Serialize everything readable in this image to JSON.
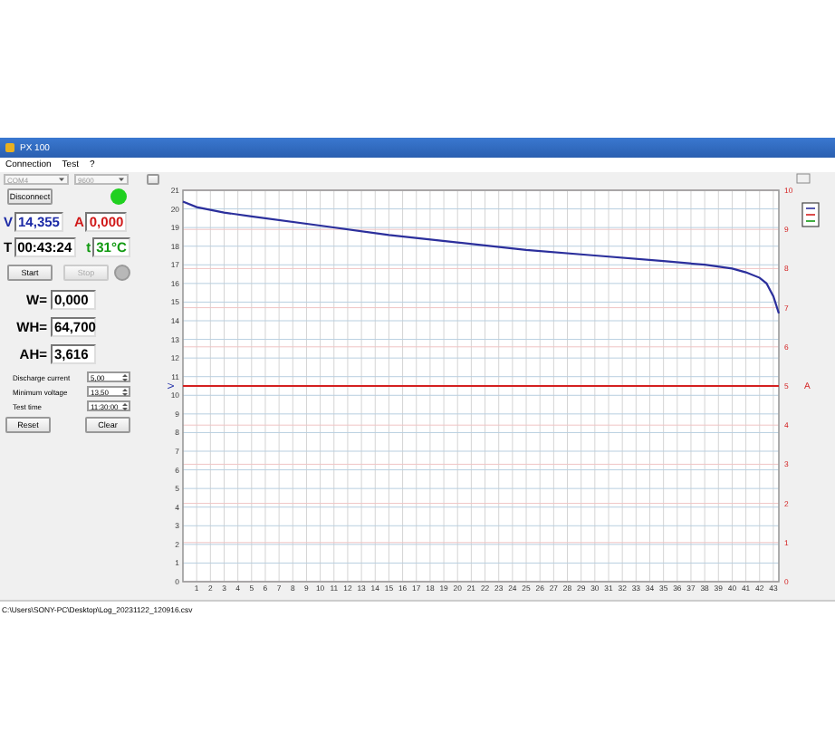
{
  "window": {
    "title": "PX 100"
  },
  "menu": [
    "Connection",
    "Test",
    "?"
  ],
  "port": {
    "value": "COM4",
    "disabled": true
  },
  "baud": {
    "value": "9600",
    "disabled": true
  },
  "connect_button": "Disconnect",
  "connected": true,
  "readings": [
    {
      "label": "V",
      "value": "14,355",
      "color": "#1c2aa6"
    },
    {
      "label": "A",
      "value": "0,000",
      "color": "#d01818"
    },
    {
      "label": "T",
      "value": "00:43:24",
      "color": "#000000"
    },
    {
      "label": "t",
      "value": "31°C",
      "color": "#129a12"
    }
  ],
  "start_button": {
    "label": "Start",
    "disabled": false
  },
  "stop_button": {
    "label": "Stop",
    "disabled": true
  },
  "running": false,
  "totals": [
    {
      "label": "W=",
      "value": "0,000"
    },
    {
      "label": "WH=",
      "value": "64,700"
    },
    {
      "label": "AH=",
      "value": "3,616"
    }
  ],
  "settings": [
    {
      "label": "Discharge current",
      "value": "5,00"
    },
    {
      "label": "Minimum voltage",
      "value": "13,50"
    },
    {
      "label": "Test time",
      "value": "11:30:00"
    }
  ],
  "buttons": [
    "Reset",
    "Clear"
  ],
  "chart": {
    "current_axis_label": "A",
    "chart_data": {
      "type": "line",
      "ylabel": "V",
      "x": [
        0,
        1,
        3,
        5,
        10,
        15,
        20,
        25,
        30,
        35,
        38,
        40,
        41,
        42,
        42.5,
        43,
        43.4
      ],
      "series": [
        {
          "color": "#2b2f9c",
          "values": [
            20.4,
            20.1,
            19.8,
            19.6,
            19.1,
            18.6,
            18.2,
            17.8,
            17.5,
            17.2,
            17.0,
            16.8,
            16.6,
            16.3,
            16.0,
            15.3,
            14.4
          ]
        },
        {
          "color": "#d42020",
          "axis": "y2",
          "values": [
            5,
            5,
            5,
            5,
            5,
            5,
            5,
            5,
            5,
            5,
            5,
            5,
            5,
            5,
            5,
            5,
            5
          ]
        }
      ],
      "grid": true,
      "xlim": [
        0,
        43.4
      ],
      "ylim": [
        0,
        21
      ],
      "y2lim": [
        0,
        10
      ],
      "xticks": [
        1,
        2,
        3,
        4,
        5,
        6,
        7,
        8,
        9,
        10,
        11,
        12,
        13,
        14,
        15,
        16,
        17,
        18,
        19,
        20,
        21,
        22,
        23,
        24,
        25,
        26,
        27,
        28,
        29,
        30,
        31,
        32,
        33,
        34,
        35,
        36,
        37,
        38,
        39,
        40,
        41,
        42,
        43
      ],
      "yticks": [
        0,
        1,
        2,
        3,
        4,
        5,
        6,
        7,
        8,
        9,
        10,
        11,
        12,
        13,
        14,
        15,
        16,
        17,
        18,
        19,
        20,
        21
      ],
      "y2ticks": [
        0,
        1,
        2,
        3,
        4,
        5,
        6,
        7,
        8,
        9,
        10
      ]
    }
  },
  "status_bar": "C:\\Users\\SONY-PC\\Desktop\\Log_20231122_120916.csv"
}
